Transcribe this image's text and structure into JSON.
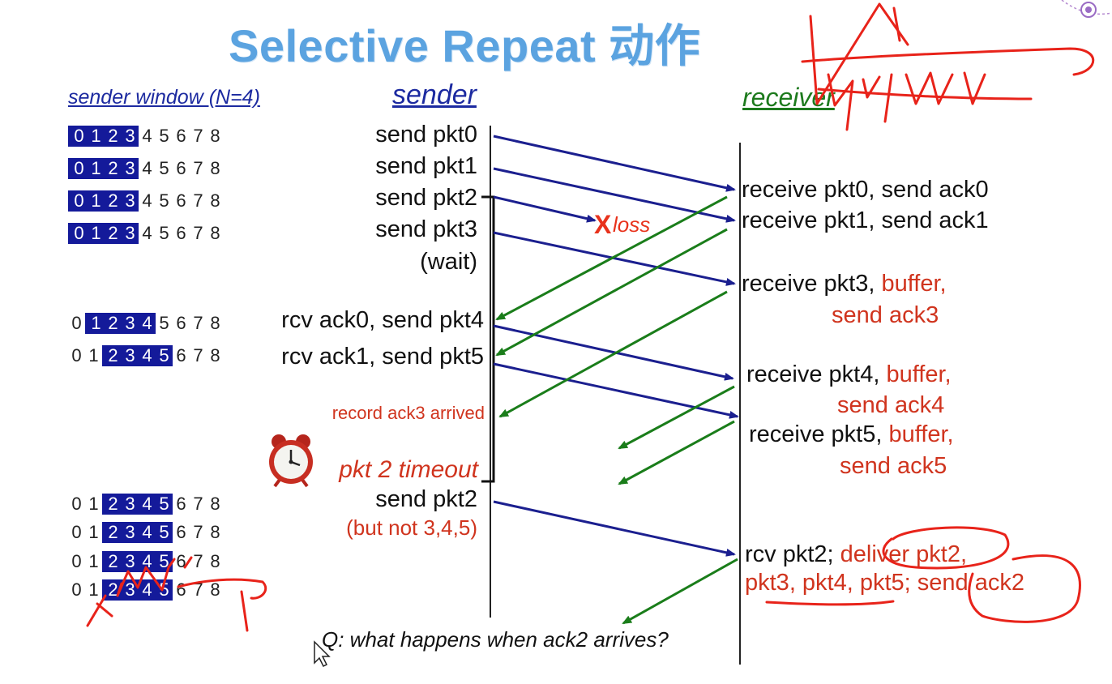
{
  "title": "Selective Repeat 动作",
  "headers": {
    "sender_window": "sender window (N=4)",
    "sender": "sender",
    "receiver": "receiver"
  },
  "window_rows": [
    {
      "digits": [
        "0",
        "1",
        "2",
        "3",
        "4",
        "5",
        "6",
        "7",
        "8"
      ],
      "highlight": [
        0,
        3
      ]
    },
    {
      "digits": [
        "0",
        "1",
        "2",
        "3",
        "4",
        "5",
        "6",
        "7",
        "8"
      ],
      "highlight": [
        0,
        3
      ]
    },
    {
      "digits": [
        "0",
        "1",
        "2",
        "3",
        "4",
        "5",
        "6",
        "7",
        "8"
      ],
      "highlight": [
        0,
        3
      ]
    },
    {
      "digits": [
        "0",
        "1",
        "2",
        "3",
        "4",
        "5",
        "6",
        "7",
        "8"
      ],
      "highlight": [
        0,
        3
      ]
    },
    {
      "digits": [
        "0",
        "1",
        "2",
        "3",
        "4",
        "5",
        "6",
        "7",
        "8"
      ],
      "highlight": [
        1,
        4
      ]
    },
    {
      "digits": [
        "0",
        "1",
        "2",
        "3",
        "4",
        "5",
        "6",
        "7",
        "8"
      ],
      "highlight": [
        2,
        5
      ]
    },
    {
      "digits": [
        "0",
        "1",
        "2",
        "3",
        "4",
        "5",
        "6",
        "7",
        "8"
      ],
      "highlight": [
        2,
        5
      ]
    },
    {
      "digits": [
        "0",
        "1",
        "2",
        "3",
        "4",
        "5",
        "6",
        "7",
        "8"
      ],
      "highlight": [
        2,
        5
      ]
    },
    {
      "digits": [
        "0",
        "1",
        "2",
        "3",
        "4",
        "5",
        "6",
        "7",
        "8"
      ],
      "highlight": [
        2,
        5
      ]
    },
    {
      "digits": [
        "0",
        "1",
        "2",
        "3",
        "4",
        "5",
        "6",
        "7",
        "8"
      ],
      "highlight": [
        2,
        5
      ]
    }
  ],
  "sender_events": {
    "send_pkt0": "send  pkt0",
    "send_pkt1": "send  pkt1",
    "send_pkt2": "send  pkt2",
    "send_pkt3": "send  pkt3",
    "wait": "(wait)",
    "ack0_pkt4": "rcv ack0, send pkt4",
    "ack1_pkt5": "rcv ack1, send pkt5",
    "record_ack3": "record ack3 arrived",
    "timeout": "pkt 2 timeout",
    "resend_pkt2": "send  pkt2",
    "but_not": "(but not 3,4,5)"
  },
  "loss": {
    "mark": "X",
    "label": "loss"
  },
  "receiver_events": {
    "r0": "receive pkt0, send ack0",
    "r1": "receive pkt1, send ack1",
    "r3_a": "receive pkt3, ",
    "r3_b": "buffer,",
    "r3_c": "send ack3",
    "r4_a": "receive pkt4, ",
    "r4_b": "buffer,",
    "r4_c": "send ack4",
    "r5_a": "receive pkt5, ",
    "r5_b": "buffer,",
    "r5_c": "send ack5",
    "r2_a": "rcv pkt2; ",
    "r2_b": "deliver pkt2,",
    "r2_c": "pkt3, pkt4, pkt5; send ack2"
  },
  "question": "Q: what happens when ack2 arrives?",
  "colors": {
    "packet_arrow": "#1b1f8f",
    "ack_arrow": "#1a7d1a",
    "annotation": "#e8231a",
    "title": "#5ba3e0",
    "window_highlight": "#141a9a"
  }
}
